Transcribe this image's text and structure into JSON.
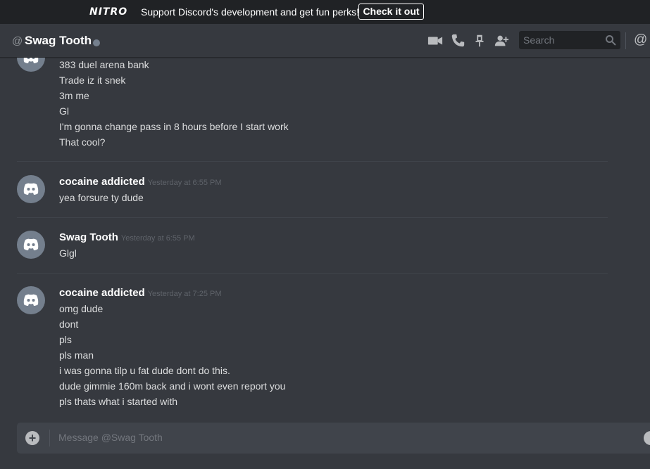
{
  "banner": {
    "logo": "NITRO",
    "text": "Support Discord's development and get fun perks!",
    "button": "Check it out"
  },
  "header": {
    "at_symbol": "@",
    "title": "Swag Tooth",
    "search_placeholder": "Search",
    "mention_symbol": "@"
  },
  "messages": {
    "group0": {
      "lines": [
        "383 duel arena bank",
        "Trade iz it snek",
        "3m me",
        "Gl",
        "I'm gonna change pass in 8 hours before I start work",
        "That cool?"
      ]
    },
    "group1": {
      "author": "cocaine addicted",
      "timestamp": "Yesterday at 6:55 PM",
      "lines": [
        "yea forsure ty dude"
      ]
    },
    "group2": {
      "author": "Swag Tooth",
      "timestamp": "Yesterday at 6:55 PM",
      "lines": [
        "Glgl"
      ]
    },
    "group3": {
      "author": "cocaine addicted",
      "timestamp": "Yesterday at 7:25 PM",
      "lines": [
        "omg dude",
        "dont",
        "pls",
        "pls man",
        "i was gonna tilp u fat dude dont do this.",
        "dude gimmie 160m back and i wont even report you",
        "pls thats what i started with"
      ]
    }
  },
  "input": {
    "placeholder": "Message @Swag Tooth"
  },
  "colors": {
    "background": "#36393f",
    "banner": "#202225",
    "input": "#40444b",
    "avatar": "#747f8d"
  }
}
